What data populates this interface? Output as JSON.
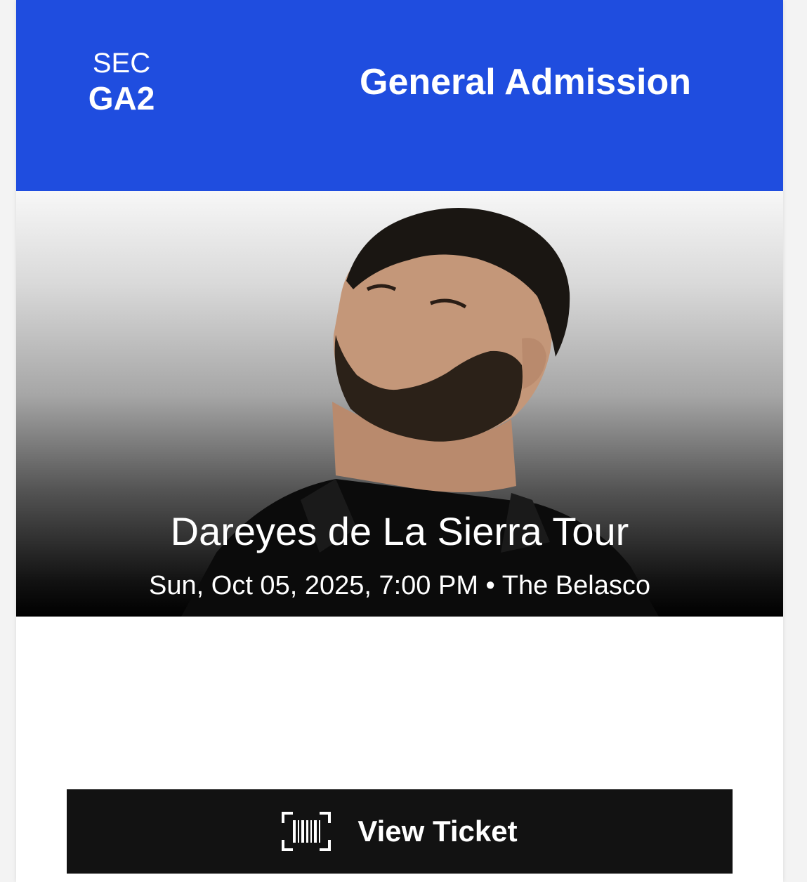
{
  "ticket": {
    "section_label": "SEC",
    "section_value": "GA2",
    "admission_type": "General Admission"
  },
  "event": {
    "title": "Dareyes de La Sierra Tour",
    "date_time": "Sun, Oct 05, 2025, 7:00 PM",
    "separator": "•",
    "venue": "The Belasco"
  },
  "actions": {
    "view_ticket_label": "View Ticket",
    "view_ticket_icon": "barcode-icon"
  },
  "colors": {
    "header_blue": "#1f4ddf",
    "button_black": "#121212"
  }
}
